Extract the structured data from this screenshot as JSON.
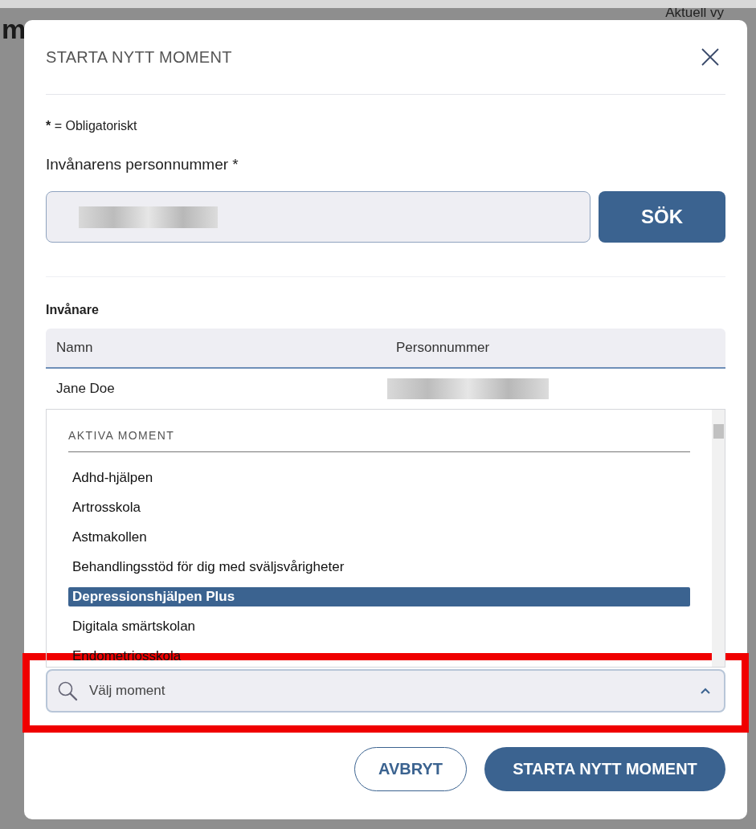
{
  "background": {
    "heading": "m",
    "view_label": "Aktuell vy"
  },
  "dialog": {
    "title": "STARTA NYTT MOMENT",
    "required_mark": "*",
    "required_note": "= Obligatoriskt",
    "ssn_label": "Invånarens personnummer *",
    "search_button": "SÖK"
  },
  "residents": {
    "title": "Invånare",
    "columns": [
      "Namn",
      "Personnummer"
    ],
    "rows": [
      {
        "name": "Jane Doe"
      }
    ]
  },
  "moment_select": {
    "expanded": true,
    "highlighted": true,
    "group_label": "AKTIVA MOMENT",
    "placeholder": "Välj moment",
    "options": [
      {
        "label": "Adhd-hjälpen",
        "selected": false
      },
      {
        "label": "Artrosskola",
        "selected": false
      },
      {
        "label": "Astmakollen",
        "selected": false
      },
      {
        "label": "Behandlingsstöd för dig med sväljsvårigheter",
        "selected": false
      },
      {
        "label": "Depressionshjälpen Plus",
        "selected": true
      },
      {
        "label": "Digitala smärtskolan",
        "selected": false
      },
      {
        "label": "Endometriosskola",
        "selected": false
      }
    ]
  },
  "buttons": [
    {
      "label": "AVBRYT",
      "kind": "secondary"
    },
    {
      "label": "STARTA NYTT MOMENT",
      "kind": "primary"
    }
  ]
}
